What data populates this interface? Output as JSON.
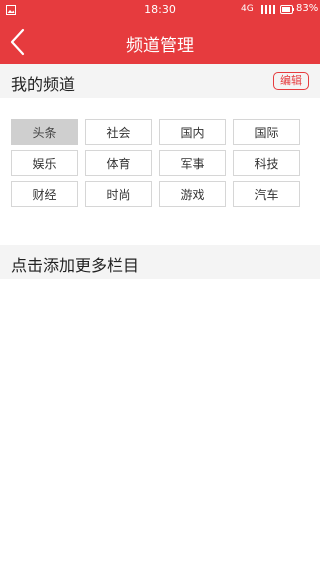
{
  "status_bar": {
    "time": "18:30",
    "network": "4G",
    "battery": "83%"
  },
  "header": {
    "title": "频道管理",
    "back_icon": "chevron-left-icon"
  },
  "my_channels": {
    "title": "我的频道",
    "edit_label": "编辑",
    "items": [
      "头条",
      "社会",
      "国内",
      "国际",
      "娱乐",
      "体育",
      "军事",
      "科技",
      "财经",
      "时尚",
      "游戏",
      "汽车"
    ],
    "selected": "头条"
  },
  "more_channels": {
    "title": "点击添加更多栏目"
  },
  "colors": {
    "accent": "#e63b3e",
    "selected_chip": "#cfcfcf"
  }
}
